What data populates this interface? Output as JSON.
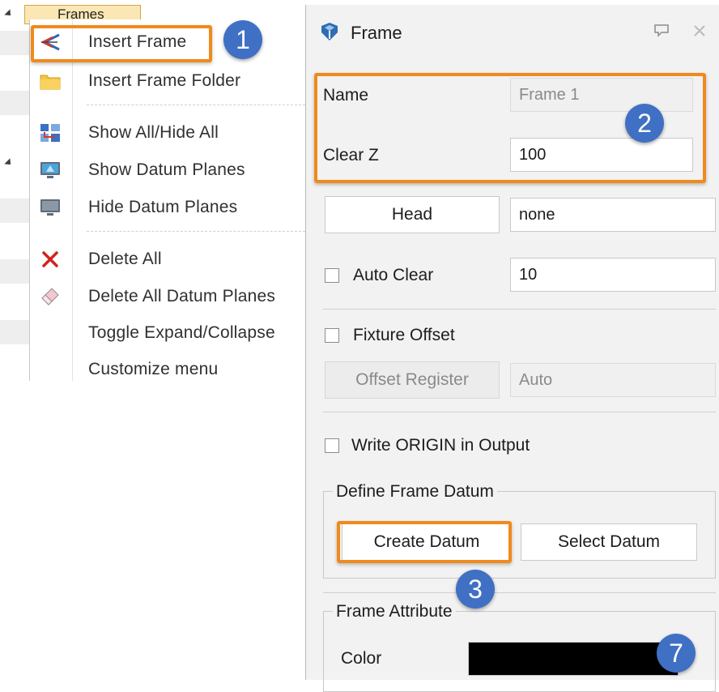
{
  "tree": {
    "node_label": "Frames"
  },
  "context_menu": {
    "items": [
      {
        "label": "Insert Frame",
        "icon": "insert-frame-icon"
      },
      {
        "label": "Insert Frame Folder",
        "icon": "folder-icon"
      },
      {
        "label": "Show All/Hide All",
        "icon": "show-hide-icon"
      },
      {
        "label": "Show Datum Planes",
        "icon": "monitor-icon"
      },
      {
        "label": "Hide Datum Planes",
        "icon": "monitor-icon"
      },
      {
        "label": "Delete All",
        "icon": "delete-x-icon"
      },
      {
        "label": "Delete All Datum Planes",
        "icon": "eraser-icon"
      },
      {
        "label": "Toggle Expand/Collapse",
        "icon": ""
      },
      {
        "label": "Customize menu",
        "icon": ""
      }
    ]
  },
  "panel": {
    "title": "Frame",
    "name_label": "Name",
    "name_value": "Frame 1",
    "clearz_label": "Clear Z",
    "clearz_value": "100",
    "head_button": "Head",
    "head_value": "none",
    "auto_clear_label": "Auto Clear",
    "auto_clear_checked": false,
    "auto_clear_value": "10",
    "fixture_offset_label": "Fixture Offset",
    "fixture_offset_checked": false,
    "offset_register_button": "Offset Register",
    "offset_register_value": "Auto",
    "write_origin_label": "Write ORIGIN in Output",
    "write_origin_checked": false,
    "define_datum_title": "Define Frame Datum",
    "create_datum_button": "Create Datum",
    "select_datum_button": "Select Datum",
    "attribute_title": "Frame Attribute",
    "color_label": "Color",
    "color_value": "#000000"
  },
  "annotations": {
    "badge1": "1",
    "badge2": "2",
    "badge3": "3",
    "badge4": "7",
    "highlight_color": "#f08a1c",
    "badge_color": "#3f70c4"
  }
}
